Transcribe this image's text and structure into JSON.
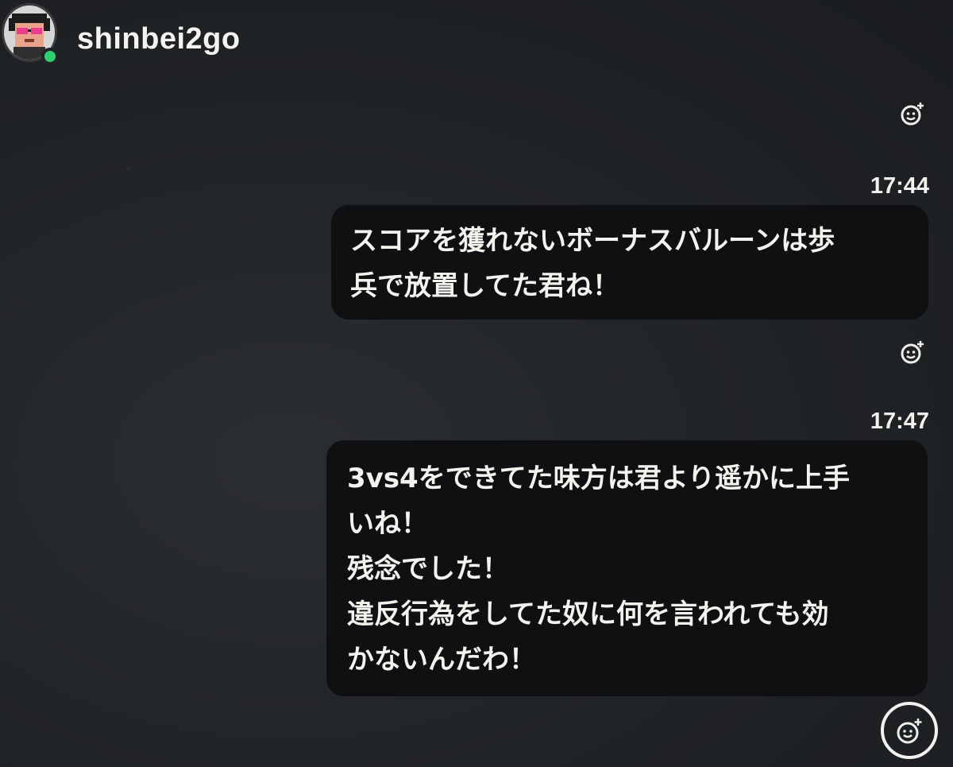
{
  "header": {
    "username": "shinbei2go",
    "avatar": "avatar-image",
    "presence": "online",
    "presence_color": "#2fcf6d"
  },
  "messages": [
    {
      "time": "17:44",
      "lines": [
        "スコアを獲れないボーナスバルーンは歩",
        "兵で放置してた君ね！"
      ]
    },
    {
      "time": "17:47",
      "lines": [
        "3vs4をできてた味方は君より遥かに上手",
        "いね！",
        "残念でした！",
        "違反行為をしてた奴に何を言われても効",
        "かないんだわ！"
      ]
    }
  ],
  "icons": {
    "reaction": "add-reaction-icon"
  },
  "colors": {
    "background": "#222528",
    "bubble": "#0f1011",
    "text": "#f3f3ee"
  }
}
